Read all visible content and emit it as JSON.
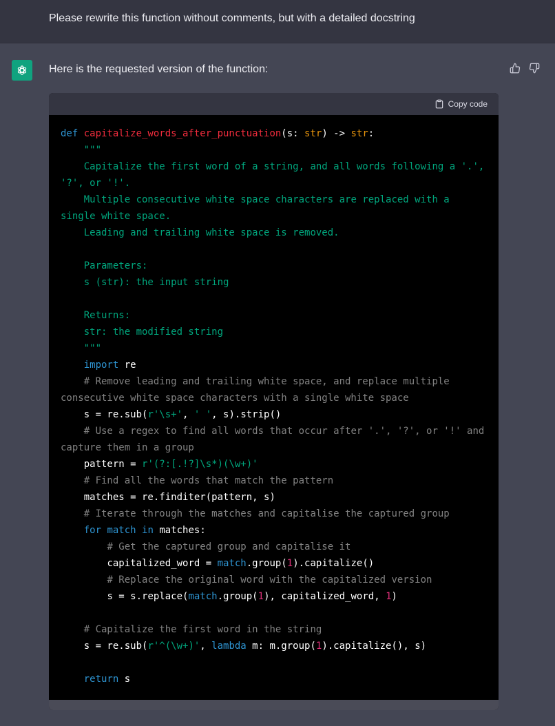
{
  "user_message": "Please rewrite this function without comments, but with a detailed docstring",
  "assistant": {
    "intro": "Here is the requested version of the function:",
    "copy_label": "Copy code",
    "avatar_icon": "openai-logo-icon",
    "accent_color": "#10a37f"
  },
  "code_lines": [
    [
      [
        "kw",
        "def "
      ],
      [
        "fn",
        "capitalize_words_after_punctuation"
      ],
      [
        "",
        "(s: "
      ],
      [
        "ty",
        "str"
      ],
      [
        "",
        ") -> "
      ],
      [
        "ty",
        "str"
      ],
      [
        "",
        ":"
      ]
    ],
    [
      [
        "str",
        "    \"\"\""
      ]
    ],
    [
      [
        "str",
        "    Capitalize the first word of a string, and all words following a '.', '?', or '!'."
      ]
    ],
    [
      [
        "str",
        "    Multiple consecutive white space characters are replaced with a single white space."
      ]
    ],
    [
      [
        "str",
        "    Leading and trailing white space is removed."
      ]
    ],
    [],
    [
      [
        "str",
        "    Parameters:"
      ]
    ],
    [
      [
        "str",
        "    s (str): the input string"
      ]
    ],
    [],
    [
      [
        "str",
        "    Returns:"
      ]
    ],
    [
      [
        "str",
        "    str: the modified string"
      ]
    ],
    [
      [
        "str",
        "    \"\"\""
      ]
    ],
    [
      [
        "",
        "    "
      ],
      [
        "kw",
        "import"
      ],
      [
        "",
        " re"
      ]
    ],
    [
      [
        "com",
        "    # Remove leading and trailing white space, and replace multiple consecutive white space characters with a single white space"
      ]
    ],
    [
      [
        "",
        "    s = re.sub("
      ],
      [
        "str",
        "r'\\s+'"
      ],
      [
        "",
        ", "
      ],
      [
        "str",
        "' '"
      ],
      [
        "",
        ", s).strip()"
      ]
    ],
    [
      [
        "com",
        "    # Use a regex to find all words that occur after '.', '?', or '!' and capture them in a group"
      ]
    ],
    [
      [
        "",
        "    pattern = "
      ],
      [
        "str",
        "r'(?:[.!?]\\s*)(\\w+)'"
      ]
    ],
    [
      [
        "com",
        "    # Find all the words that match the pattern"
      ]
    ],
    [
      [
        "",
        "    matches = re.finditer(pattern, s)"
      ]
    ],
    [
      [
        "com",
        "    # Iterate through the matches and capitalise the captured group"
      ]
    ],
    [
      [
        "",
        "    "
      ],
      [
        "kw",
        "for"
      ],
      [
        "kw",
        " match"
      ],
      [
        "kw",
        " in"
      ],
      [
        "",
        " matches:"
      ]
    ],
    [
      [
        "com",
        "        # Get the captured group and capitalise it"
      ]
    ],
    [
      [
        "",
        "        capitalized_word = "
      ],
      [
        "kw",
        "match"
      ],
      [
        "",
        ".group("
      ],
      [
        "num",
        "1"
      ],
      [
        "",
        ").capitalize()"
      ]
    ],
    [
      [
        "com",
        "        # Replace the original word with the capitalized version"
      ]
    ],
    [
      [
        "",
        "        s = s.replace("
      ],
      [
        "kw",
        "match"
      ],
      [
        "",
        ".group("
      ],
      [
        "num",
        "1"
      ],
      [
        "",
        "), capitalized_word, "
      ],
      [
        "num",
        "1"
      ],
      [
        "",
        ")"
      ]
    ],
    [],
    [
      [
        "com",
        "    # Capitalize the first word in the string"
      ]
    ],
    [
      [
        "",
        "    s = re.sub("
      ],
      [
        "str",
        "r'^(\\w+)'"
      ],
      [
        "",
        ", "
      ],
      [
        "kw",
        "lambda"
      ],
      [
        "",
        " m: m.group("
      ],
      [
        "num",
        "1"
      ],
      [
        "",
        ").capitalize(), s)"
      ]
    ],
    [],
    [
      [
        "",
        "    "
      ],
      [
        "kw",
        "return"
      ],
      [
        "",
        " s"
      ]
    ]
  ]
}
